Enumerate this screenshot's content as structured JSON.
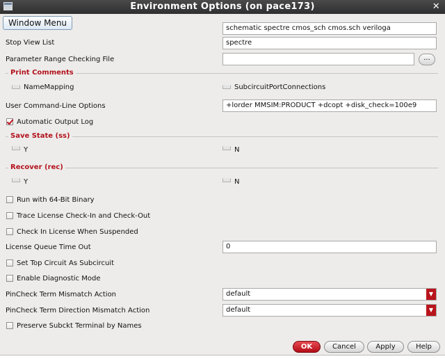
{
  "window": {
    "title": "Environment Options (on pace173)"
  },
  "window_menu": {
    "label": "Window Menu"
  },
  "fields": {
    "netlist_views": "schematic spectre cmos_sch cmos.sch veriloga",
    "stop_view_list_label": "Stop View List",
    "stop_view_list_value": "spectre",
    "param_range_label": "Parameter Range Checking File",
    "param_range_value": "",
    "param_range_browse": "...",
    "user_cmd_label": "User Command-Line Options",
    "user_cmd_value": "+lorder MMSIM:PRODUCT +dcopt +disk_check=100e9",
    "license_queue_label": "License Queue Time Out",
    "license_queue_value": "0"
  },
  "print_comments": {
    "title": "Print Comments",
    "name_mapping": "NameMapping",
    "subcircuit_port": "SubcircuitPortConnections"
  },
  "automatic_output_log": {
    "label": "Automatic Output Log",
    "checked": true
  },
  "save_state": {
    "title": "Save State (ss)",
    "y": "Y",
    "n": "N"
  },
  "recover": {
    "title": "Recover (rec)",
    "y": "Y",
    "n": "N"
  },
  "checkboxes": {
    "run64": "Run with 64-Bit Binary",
    "trace_license": "Trace License Check-In and Check-Out",
    "checkin_suspended": "Check In License When Suspended",
    "top_subckt": "Set Top Circuit As Subcircuit",
    "diagnostic": "Enable Diagnostic Mode",
    "preserve_subckt": "Preserve Subckt Terminal by Names"
  },
  "pincheck": {
    "term_mismatch_label": "PinCheck Term Mismatch Action",
    "term_mismatch_value": "default",
    "direction_mismatch_label": "PinCheck Term Direction Mismatch Action",
    "direction_mismatch_value": "default"
  },
  "buttons": {
    "ok": "OK",
    "cancel": "Cancel",
    "apply": "Apply",
    "help": "Help"
  },
  "colors": {
    "accent_red": "#b9141c",
    "titlebar": "#3a3a3a",
    "background": "#edecea"
  }
}
